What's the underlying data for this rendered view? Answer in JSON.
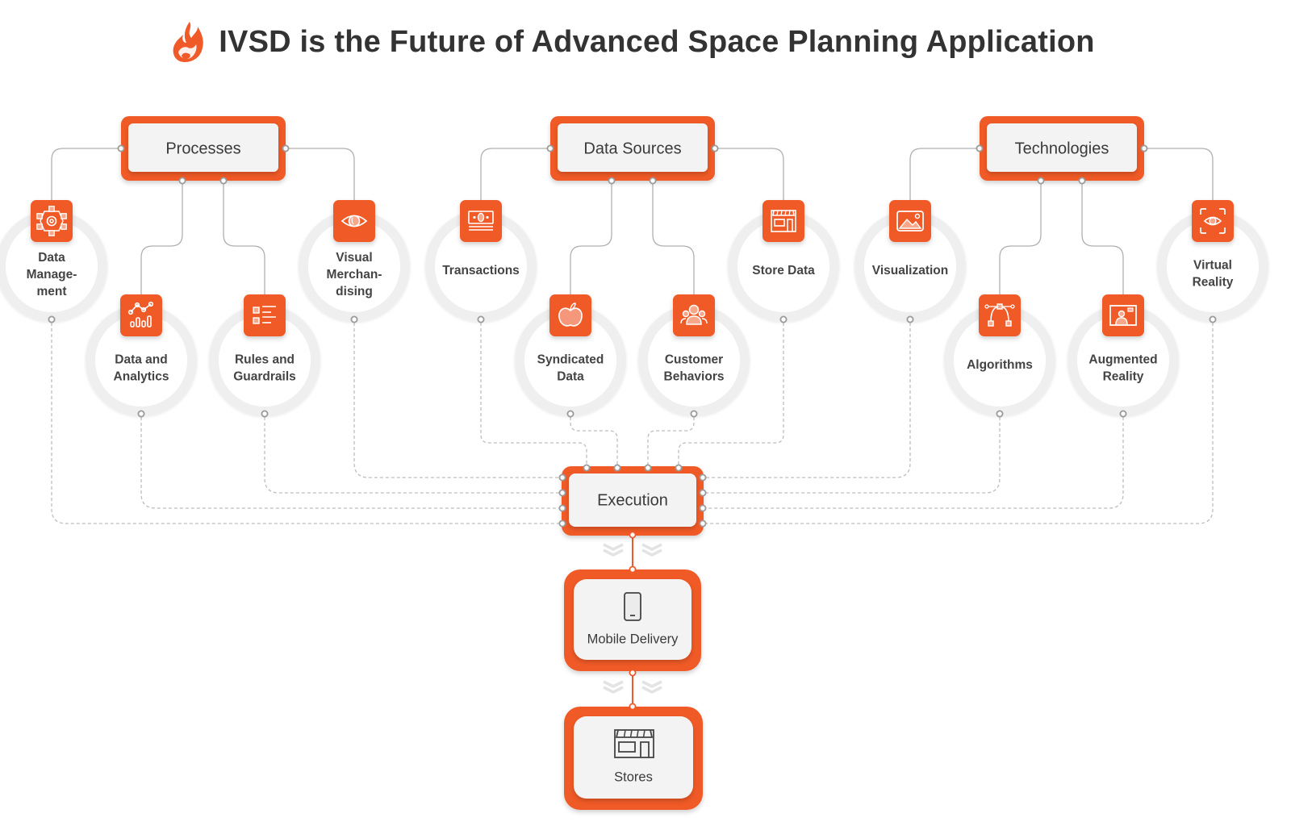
{
  "header": {
    "title": "IVSD is the Future of Advanced Space Planning Application",
    "logo_icon": "flame-icon"
  },
  "colors": {
    "accent": "#F05A28",
    "box_fill": "#F3F3F3",
    "ring": "#EFEFEF",
    "connector": "#AAAAAA",
    "text": "#333333"
  },
  "categories": [
    {
      "label": "Processes",
      "items": [
        {
          "label_lines": [
            "Data",
            "Manage-",
            "ment"
          ],
          "icon": "network-gear-icon"
        },
        {
          "label_lines": [
            "Data and",
            "Analytics"
          ],
          "icon": "analytics-chart-icon"
        },
        {
          "label_lines": [
            "Rules and",
            "Guardrails"
          ],
          "icon": "checklist-icon"
        },
        {
          "label_lines": [
            "Visual",
            "Merchan-",
            "dising"
          ],
          "icon": "eye-icon"
        }
      ]
    },
    {
      "label": "Data Sources",
      "items": [
        {
          "label_lines": [
            "Transactions"
          ],
          "icon": "banknote-icon"
        },
        {
          "label_lines": [
            "Syndicated",
            "Data"
          ],
          "icon": "apple-icon"
        },
        {
          "label_lines": [
            "Customer",
            "Behaviors"
          ],
          "icon": "group-users-icon"
        },
        {
          "label_lines": [
            "Store Data"
          ],
          "icon": "storefront-icon"
        }
      ]
    },
    {
      "label": "Technologies",
      "items": [
        {
          "label_lines": [
            "Visualization"
          ],
          "icon": "image-icon"
        },
        {
          "label_lines": [
            "Algorithms"
          ],
          "icon": "bezier-curve-icon"
        },
        {
          "label_lines": [
            "Augmented",
            "Reality"
          ],
          "icon": "ar-screen-user-icon"
        },
        {
          "label_lines": [
            "Virtual",
            "Reality"
          ],
          "icon": "vr-eye-scan-icon"
        }
      ]
    }
  ],
  "execution": {
    "label": "Execution"
  },
  "mobile_delivery": {
    "label": "Mobile Delivery",
    "icon": "smartphone-icon"
  },
  "stores": {
    "label": "Stores",
    "icon": "storefront-icon"
  }
}
